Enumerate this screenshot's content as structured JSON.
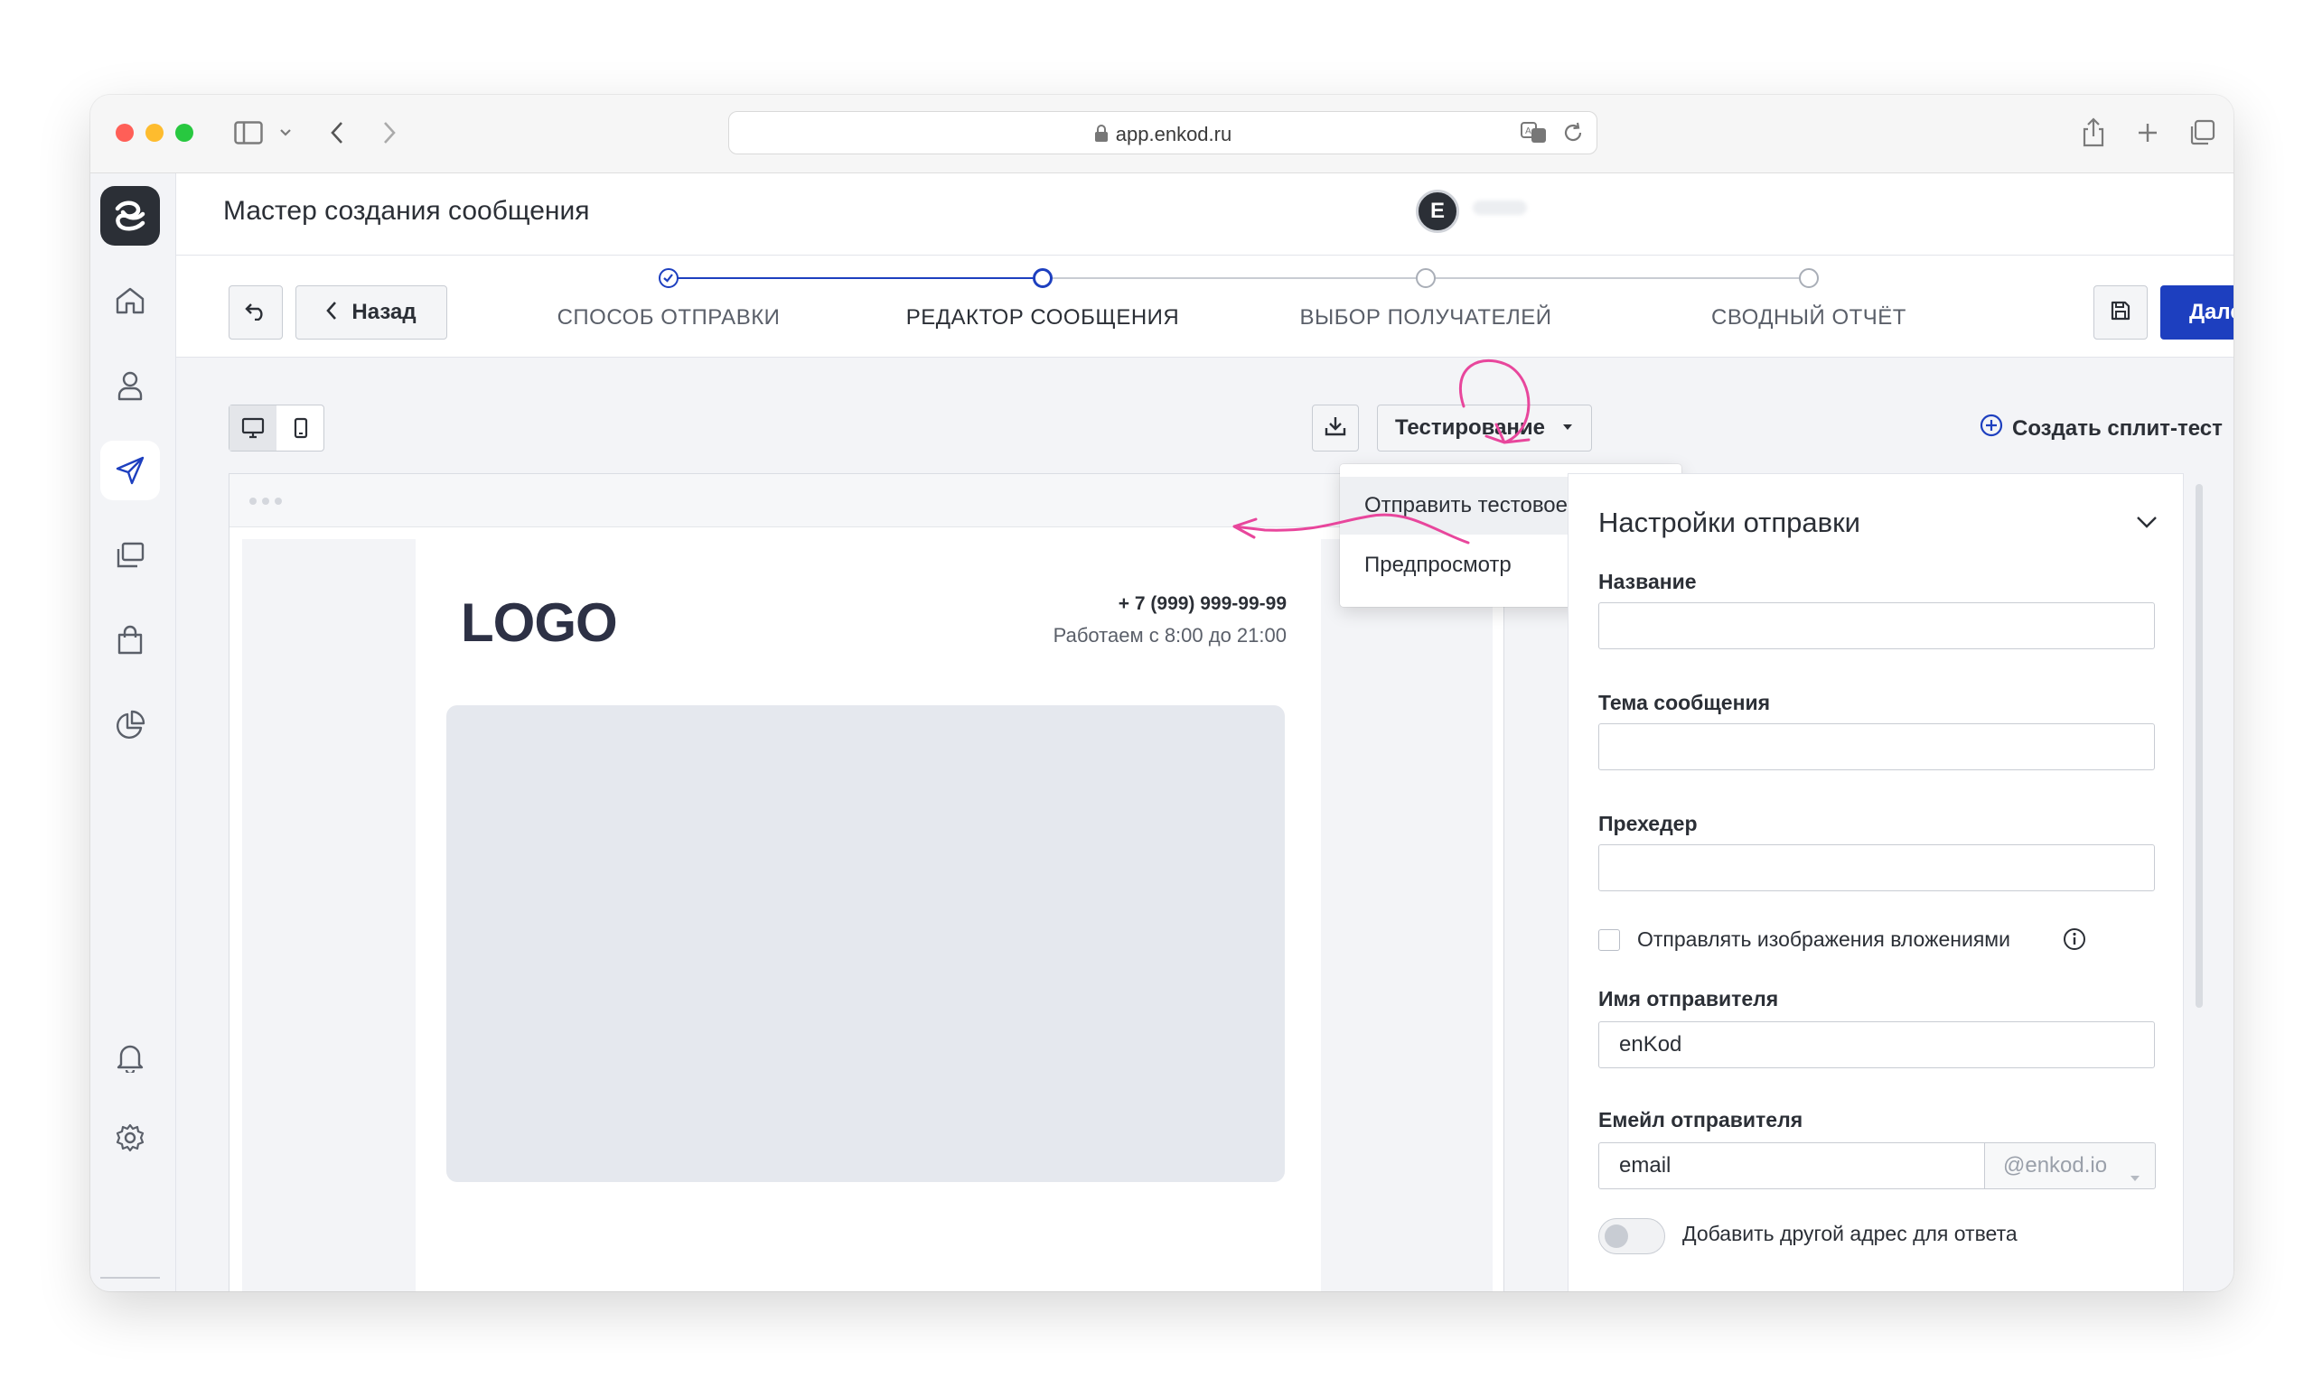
{
  "browser": {
    "url": "app.enkod.ru"
  },
  "header": {
    "title": "Мастер создания сообщения",
    "avatar_letter": "E"
  },
  "stepper": {
    "back_label": "Назад",
    "next_label": "Далее",
    "steps": [
      {
        "label": "СПОСОБ ОТПРАВКИ",
        "state": "done"
      },
      {
        "label": "РЕДАКТОР СООБЩЕНИЯ",
        "state": "current"
      },
      {
        "label": "ВЫБОР ПОЛУЧАТЕЛЕЙ",
        "state": "todo"
      },
      {
        "label": "СВОДНЫЙ ОТЧЁТ",
        "state": "todo"
      }
    ]
  },
  "toolbar": {
    "testing_label": "Тестирование",
    "split_test_label": "Создать сплит-тест",
    "menu": [
      {
        "label": "Отправить тестовое письмо",
        "highlighted": true
      },
      {
        "label": "Предпросмотр",
        "highlighted": false
      }
    ]
  },
  "email_preview": {
    "logo": "LOGO",
    "phone": "+ 7 (999) 999-99-99",
    "hours": "Работаем с 8:00 до 21:00"
  },
  "settings": {
    "title": "Настройки отправки",
    "name_label": "Название",
    "name_value": "",
    "subject_label": "Тема сообщения",
    "subject_value": "",
    "preheader_label": "Прехедер",
    "preheader_value": "",
    "attach_images_label": "Отправлять изображения вложениями",
    "attach_images_checked": false,
    "sender_name_label": "Имя отправителя",
    "sender_name_value": "enKod",
    "sender_email_label": "Емейл отправителя",
    "sender_email_value": "email",
    "sender_domain": "@enkod.io",
    "reply_to_label": "Добавить другой адрес для ответа",
    "reply_to_enabled": false
  },
  "colors": {
    "primary": "#1d3fbf",
    "annotation": "#e8469c"
  }
}
